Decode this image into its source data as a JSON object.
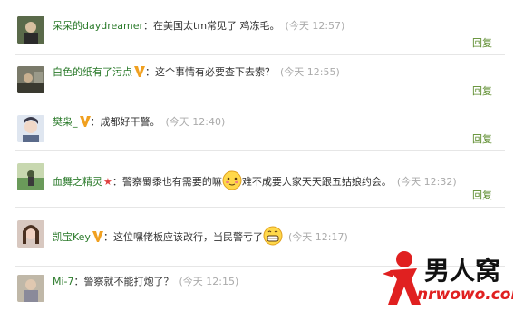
{
  "comments": [
    {
      "name": "呆呆的daydreamer",
      "sep": "：",
      "text": "在美国太tm常见了 鸡冻毛。",
      "time": "(今天 12:57)",
      "reply": "回复"
    },
    {
      "name": "白色的纸有了污点",
      "sep": "：",
      "text": "这个事情有必要查下去索？",
      "time": "(今天 12:55)",
      "reply": "回复"
    },
    {
      "name": "樊枭_",
      "sep": "：",
      "text": "成都好干警。",
      "time": "(今天 12:40)",
      "reply": "回复"
    },
    {
      "name": "血舞之精灵",
      "sep": "：",
      "text": "警察蜀黍也有需要的嘛",
      "text2": "难不成要人家天天跟五姑娘约会。",
      "time": "(今天 12:32)",
      "reply": "回复"
    },
    {
      "name": "凯宝Key",
      "sep": "：",
      "text": "这位嘿佬板应该改行，当民警亏了",
      "time": "(今天 12:17)",
      "reply": "回复"
    },
    {
      "name": "Mi-7",
      "sep": "：",
      "text": "警察就不能打炮了？",
      "time": "(今天 12:15)"
    }
  ],
  "watermark": {
    "cn": "男人窝",
    "url": "nrwowo.com"
  },
  "colors": {
    "name": "#2a7a2a",
    "reply": "#5a8a2a",
    "time": "#aaaaaa",
    "vip": "#f0a020"
  }
}
